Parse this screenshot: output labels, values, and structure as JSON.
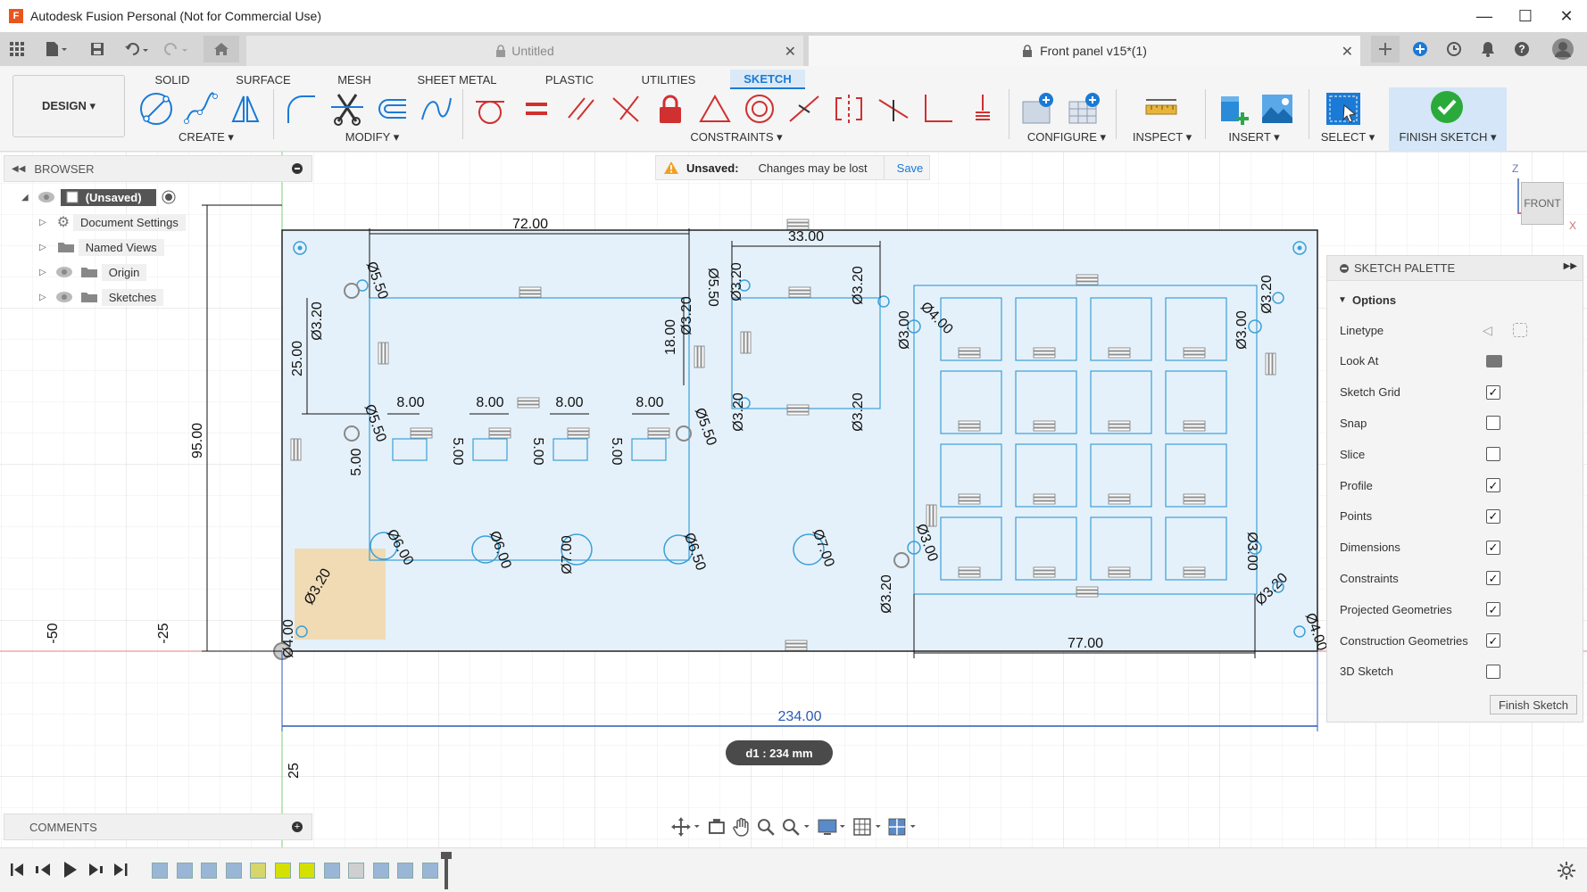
{
  "app": {
    "title": "Autodesk Fusion Personal (Not for Commercial Use)",
    "logo_letter": "F"
  },
  "window_controls": {
    "minimize": "—",
    "maximize": "☐",
    "close": "✕"
  },
  "tabs": [
    {
      "label": "Untitled",
      "active": false
    },
    {
      "label": "Front panel v15*(1)",
      "active": true
    }
  ],
  "workspace_tabs": [
    "SOLID",
    "SURFACE",
    "MESH",
    "SHEET METAL",
    "PLASTIC",
    "UTILITIES",
    "SKETCH"
  ],
  "active_workspace_tab": "SKETCH",
  "design_button": "DESIGN ▾",
  "tool_groups": {
    "create": "CREATE ▾",
    "modify": "MODIFY ▾",
    "constraints": "CONSTRAINTS ▾",
    "configure": "CONFIGURE ▾",
    "inspect": "INSPECT ▾",
    "insert": "INSERT ▾",
    "select": "SELECT ▾",
    "finish_sketch": "FINISH SKETCH ▾"
  },
  "browser": {
    "title": "BROWSER",
    "items": [
      {
        "label": "(Unsaved)"
      },
      {
        "label": "Document Settings"
      },
      {
        "label": "Named Views"
      },
      {
        "label": "Origin"
      },
      {
        "label": "Sketches"
      }
    ]
  },
  "notice": {
    "title": "Unsaved:",
    "message": "Changes may be lost",
    "action": "Save"
  },
  "view_cube": {
    "face": "FRONT",
    "axis_z": "Z",
    "axis_x": "X"
  },
  "sketch_palette": {
    "title": "SKETCH PALETTE",
    "section": "Options",
    "rows": [
      {
        "label": "Linetype",
        "type": "icons"
      },
      {
        "label": "Look At",
        "type": "icon"
      },
      {
        "label": "Sketch Grid",
        "checked": true
      },
      {
        "label": "Snap",
        "checked": false
      },
      {
        "label": "Slice",
        "checked": false
      },
      {
        "label": "Profile",
        "checked": true
      },
      {
        "label": "Points",
        "checked": true
      },
      {
        "label": "Dimensions",
        "checked": true
      },
      {
        "label": "Constraints",
        "checked": true
      },
      {
        "label": "Projected Geometries",
        "checked": true
      },
      {
        "label": "Construction Geometries",
        "checked": true
      },
      {
        "label": "3D Sketch",
        "checked": false
      }
    ],
    "finish_button": "Finish Sketch",
    "check_mark": "✓"
  },
  "dimensions": {
    "d72": "72.00",
    "d33": "33.00",
    "d25": "25.00",
    "d18": "18.00",
    "d8a": "8.00",
    "d8b": "8.00",
    "d8c": "8.00",
    "d8d": "8.00",
    "d95": "95.00",
    "d77": "77.00",
    "d234": "234.00",
    "d5a": "5.00",
    "d5b": "5.00",
    "d5c": "5.00",
    "d5d": "5.00",
    "dia_320": "Ø3.20",
    "dia_600": "Ø6.00",
    "dia_700": "Ø7.00",
    "dia_650": "Ø6.50",
    "dia_300": "Ø3.00",
    "dia_400": "Ø4.00",
    "dia_550": "Ø5.50",
    "axis_m50": "-50",
    "axis_m25": "-25",
    "axis_25": "25"
  },
  "measure_pill": "d1 : 234 mm",
  "comments": {
    "title": "COMMENTS"
  },
  "colors": {
    "accent": "#1a7ad6",
    "sketch_line": "#3aa0d8",
    "sketch_fill": "#e5f1fa",
    "profile_fill": "#f2d7a8",
    "grid": "#e4e4e4",
    "dimension": "#111111"
  }
}
